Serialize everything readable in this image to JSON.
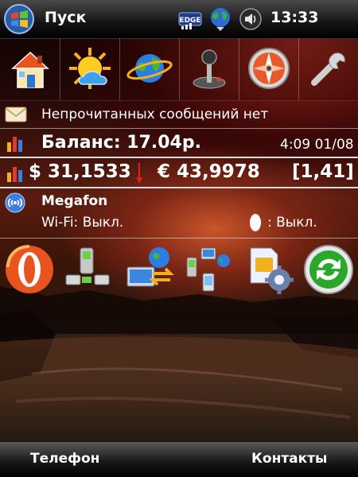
{
  "taskbar": {
    "start_label": "Пуск",
    "edge_label": "EDGE",
    "time": "13:33",
    "icons": [
      "windows-logo-icon",
      "edge-signal-icon",
      "globe-connection-icon",
      "volume-icon"
    ]
  },
  "app_shortcuts": [
    "home-icon",
    "weather-sun-icon",
    "internet-planet-icon",
    "joystick-game-icon",
    "compass-icon",
    "wrench-settings-icon"
  ],
  "messages": {
    "text": "Непрочитанных сообщений нет"
  },
  "balance": {
    "text": "Баланс: 17.04р.",
    "datetime": "4:09 01/08"
  },
  "rates": {
    "usd": "$ 31,1533",
    "eur": "€ 43,9978",
    "ratio": "[1,41]",
    "trend": "down"
  },
  "connectivity": {
    "operator": "Megafon",
    "wifi": "Wi-Fi: Выкл.",
    "bluetooth": ": Выкл."
  },
  "tools": [
    "opera-browser-icon",
    "phone-modem-icon",
    "pc-sync-icon",
    "devices-network-icon",
    "sim-settings-icon",
    "refresh-sync-icon"
  ],
  "softkeys": {
    "left": "Телефон",
    "right": "Контакты"
  },
  "colors": {
    "accent_red": "#c8281e",
    "bar_gold": "#f0b020",
    "text": "#ffffff"
  }
}
